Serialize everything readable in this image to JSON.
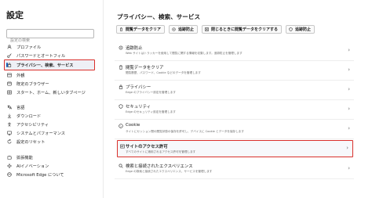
{
  "sidebar": {
    "title": "設定",
    "search_placeholder": "設定の検索",
    "items": [
      {
        "label": "プロファイル",
        "icon": "profile-icon"
      },
      {
        "label": "パスワードとオートフィル",
        "icon": "key-icon"
      },
      {
        "label": "プライバシー、検索、サービス",
        "icon": "lock-icon",
        "active": true
      },
      {
        "label": "外観",
        "icon": "appearance-icon"
      },
      {
        "label": "既定のブラウザー",
        "icon": "browser-icon"
      },
      {
        "label": "スタート、ホーム、新しいタブページ",
        "icon": "home-icon"
      },
      {
        "label": "言語",
        "icon": "language-icon"
      },
      {
        "label": "ダウンロード",
        "icon": "download-icon"
      },
      {
        "label": "アクセシビリティ",
        "icon": "accessibility-icon"
      },
      {
        "label": "システムとパフォーマンス",
        "icon": "system-icon"
      },
      {
        "label": "設定のリセット",
        "icon": "reset-icon"
      },
      {
        "label": "拡張機能",
        "icon": "extensions-icon"
      },
      {
        "label": "AIイノベーション",
        "icon": "ai-icon"
      },
      {
        "label": "Microsoft Edge について",
        "icon": "edge-icon"
      }
    ]
  },
  "main": {
    "title": "プライバシー、検索、サービス",
    "quick_actions": [
      {
        "label": "閲覧データをクリア",
        "icon": "clear-data-icon"
      },
      {
        "label": "追跡防止",
        "icon": "tracking-icon"
      },
      {
        "label": "閉じるときに閲覧データをクリアする",
        "icon": "close-clear-icon"
      },
      {
        "label": "追跡防止",
        "icon": "shield-icon"
      }
    ],
    "rows": [
      {
        "title": "追跡防止",
        "desc": "Web サイトはトラッカーを使用して閲覧に関する情報を収集します。追跡防止を管理します",
        "icon": "tracking-icon"
      },
      {
        "title": "閲覧データをクリア",
        "desc": "閲覧履歴、パスワード、Cookie などのデータを管理します",
        "icon": "clear-data-icon"
      },
      {
        "title": "プライバシー",
        "desc": "Edge のプライバシー設定を管理します",
        "icon": "privacy-icon"
      },
      {
        "title": "セキュリティ",
        "desc": "Edge のセキュリティ設定を管理します",
        "icon": "security-icon"
      },
      {
        "title": "Cookie",
        "desc": "サイトにセッション間の閲覧状態の保存を許可し、デバイスに Cookie とデータを保存します",
        "icon": "cookie-icon"
      },
      {
        "title": "サイトのアクセス許可",
        "desc": "すべてのサイトに適用されるアクセス許可を管理します",
        "icon": "site-permissions-icon",
        "highlighted": true
      },
      {
        "title": "検索と接続されたエクスペリエンス",
        "desc": "Edge の検索と接続されたエクスペリエンス、サービスを管理します",
        "icon": "search-icon"
      }
    ],
    "chevron": "›"
  }
}
